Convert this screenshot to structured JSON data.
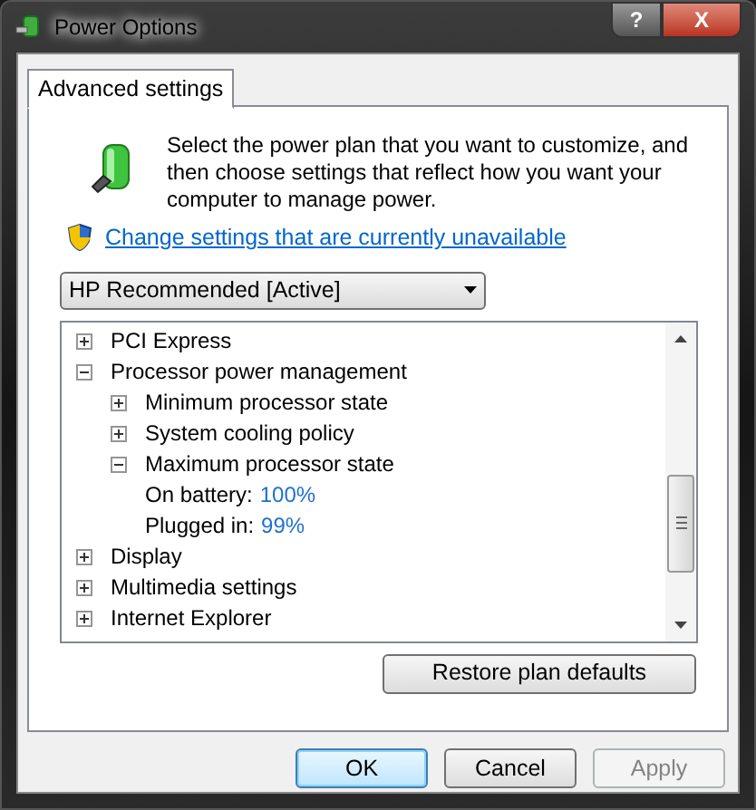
{
  "window": {
    "title": "Power Options",
    "buttons": [
      "?",
      "X"
    ]
  },
  "tabs": [
    {
      "label": "Advanced settings",
      "selected": true
    }
  ],
  "intro": "Select the power plan that you want to customize, and then choose settings that reflect how you want your computer to manage power.",
  "link": "Change settings that are currently unavailable",
  "plan": {
    "value": "HP Recommended [Active]"
  },
  "tree": [
    {
      "kind": "node",
      "label": "PCI Express",
      "expanded": false
    },
    {
      "kind": "node",
      "label": "Processor power management",
      "expanded": true,
      "children": [
        {
          "kind": "node",
          "label": "Minimum processor state",
          "expanded": false
        },
        {
          "kind": "node",
          "label": "System cooling policy",
          "expanded": false
        },
        {
          "kind": "node",
          "label": "Maximum processor state",
          "expanded": true,
          "children": [
            {
              "kind": "setting",
              "label": "On battery:",
              "value": "100%"
            },
            {
              "kind": "setting",
              "label": "Plugged in:",
              "value": "99%"
            }
          ]
        }
      ]
    },
    {
      "kind": "node",
      "label": "Display",
      "expanded": false
    },
    {
      "kind": "node",
      "label": "Multimedia settings",
      "expanded": false
    },
    {
      "kind": "node",
      "label": "Internet Explorer",
      "expanded": false
    }
  ],
  "restore_button": "Restore plan defaults",
  "buttons": [
    {
      "label": "OK",
      "default": true,
      "disabled": false
    },
    {
      "label": "Cancel",
      "default": false,
      "disabled": false
    },
    {
      "label": "Apply",
      "default": false,
      "disabled": true
    }
  ]
}
